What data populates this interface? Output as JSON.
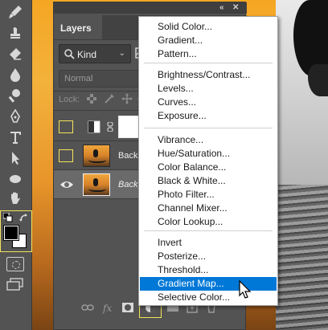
{
  "toolbar": {
    "tools": [
      "brush-tool",
      "clone-stamp-tool",
      "history-brush-tool",
      "eraser-tool",
      "blur-tool",
      "dodge-tool",
      "pen-tool",
      "type-tool",
      "path-selection-tool",
      "shape-tool",
      "hand-tool",
      "zoom-tool"
    ],
    "foreground_color": "#000000",
    "background_color": "#ffffff"
  },
  "layers_panel": {
    "tab_label": "Layers",
    "filter_kind": "Kind",
    "blend_mode": "Normal",
    "lock_label": "Lock:",
    "layers": [
      {
        "name": "",
        "type": "adjustment",
        "visible": false,
        "selected": false
      },
      {
        "name": "Backgr",
        "type": "pixel",
        "visible": false,
        "selected": false,
        "italic": false
      },
      {
        "name": "Backgro",
        "type": "pixel",
        "visible": true,
        "selected": true,
        "italic": true
      }
    ],
    "footer_icons": [
      "link-layers-icon",
      "fx-icon",
      "add-mask-icon",
      "new-adjustment-layer-icon",
      "group-icon",
      "new-layer-icon",
      "delete-layer-icon"
    ]
  },
  "adjustment_menu": {
    "groups": [
      [
        "Solid Color...",
        "Gradient...",
        "Pattern..."
      ],
      [
        "Brightness/Contrast...",
        "Levels...",
        "Curves...",
        "Exposure..."
      ],
      [
        "Vibrance...",
        "Hue/Saturation...",
        "Color Balance...",
        "Black & White...",
        "Photo Filter...",
        "Channel Mixer...",
        "Color Lookup..."
      ],
      [
        "Invert",
        "Posterize...",
        "Threshold...",
        "Gradient Map...",
        "Selective Color..."
      ]
    ],
    "highlighted_item": "Gradient Map...",
    "highlight_color": "#0078d7"
  },
  "colors": {
    "selection_outline": "#f2e35a"
  }
}
